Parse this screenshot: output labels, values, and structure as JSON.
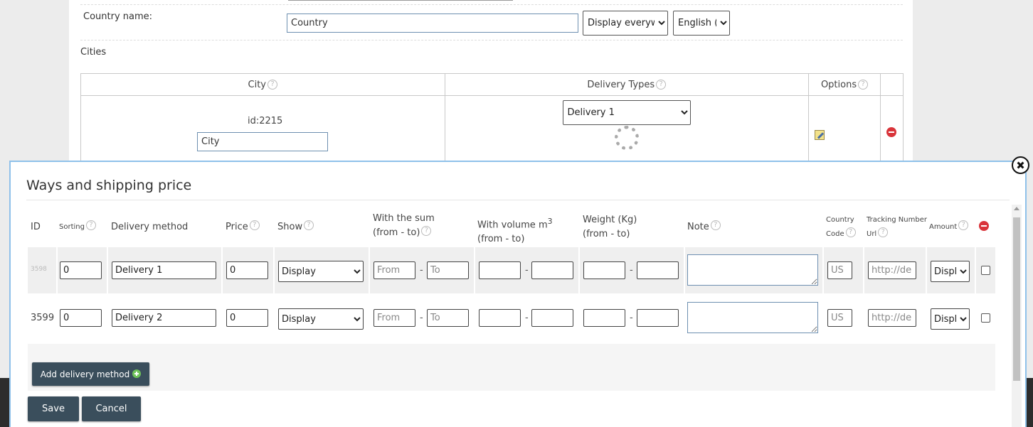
{
  "country": {
    "name_label": "Country name:",
    "name_value": "Country",
    "display_select": "Display everywhere",
    "language_select": "English (en)"
  },
  "cities": {
    "section_label": "Cities",
    "headers": {
      "city": "City",
      "delivery_types": "Delivery Types",
      "options": "Options"
    },
    "row": {
      "id_text": "id:2215",
      "city_value": "City",
      "delivery_select": "Delivery 1",
      "help_glyph": "?"
    }
  },
  "modal": {
    "title": "Ways and shipping price",
    "headers": {
      "id": "ID",
      "sorting": "Sorting",
      "delivery_method": "Delivery method",
      "price": "Price",
      "show": "Show",
      "with_sum_line1": "With the sum",
      "with_sum_line2": "(from - to)",
      "with_volume_line1": "With volume m",
      "with_volume_sup": "3",
      "with_volume_line2": "(from - to)",
      "weight_line1": "Weight (Kg)",
      "weight_line2": "(from - to)",
      "note": "Note",
      "country_line1": "Country",
      "country_line2": "Code",
      "tracking_line1": "Tracking Number",
      "tracking_line2": "Url",
      "amount": "Amount"
    },
    "rows": [
      {
        "id": "3598",
        "sorting": "0",
        "method": "Delivery 1",
        "price": "0",
        "show": "Display",
        "sum_from_ph": "From",
        "sum_to_ph": "To",
        "dash": "-",
        "country_ph": "US",
        "tracking_ph": "http://de",
        "amount": "Display"
      },
      {
        "id": "3599",
        "sorting": "0",
        "method": "Delivery 2",
        "price": "0",
        "show": "Display",
        "sum_from_ph": "From",
        "sum_to_ph": "To",
        "dash": "-",
        "country_ph": "US",
        "tracking_ph": "http://de",
        "amount": "Display"
      }
    ],
    "add_button": "Add delivery method",
    "save_button": "Save",
    "cancel_button": "Cancel"
  },
  "icons": {
    "close": "close-icon",
    "help": "help-icon",
    "remove": "minus-circle-icon",
    "add": "plus-circle-icon",
    "edit": "edit-icon",
    "spinner": "loading-spinner-icon"
  },
  "colors": {
    "button_bg": "#3a4e5c",
    "modal_border": "#8fc1ea",
    "remove_red": "#d9343a",
    "add_green": "#6fc25a"
  }
}
